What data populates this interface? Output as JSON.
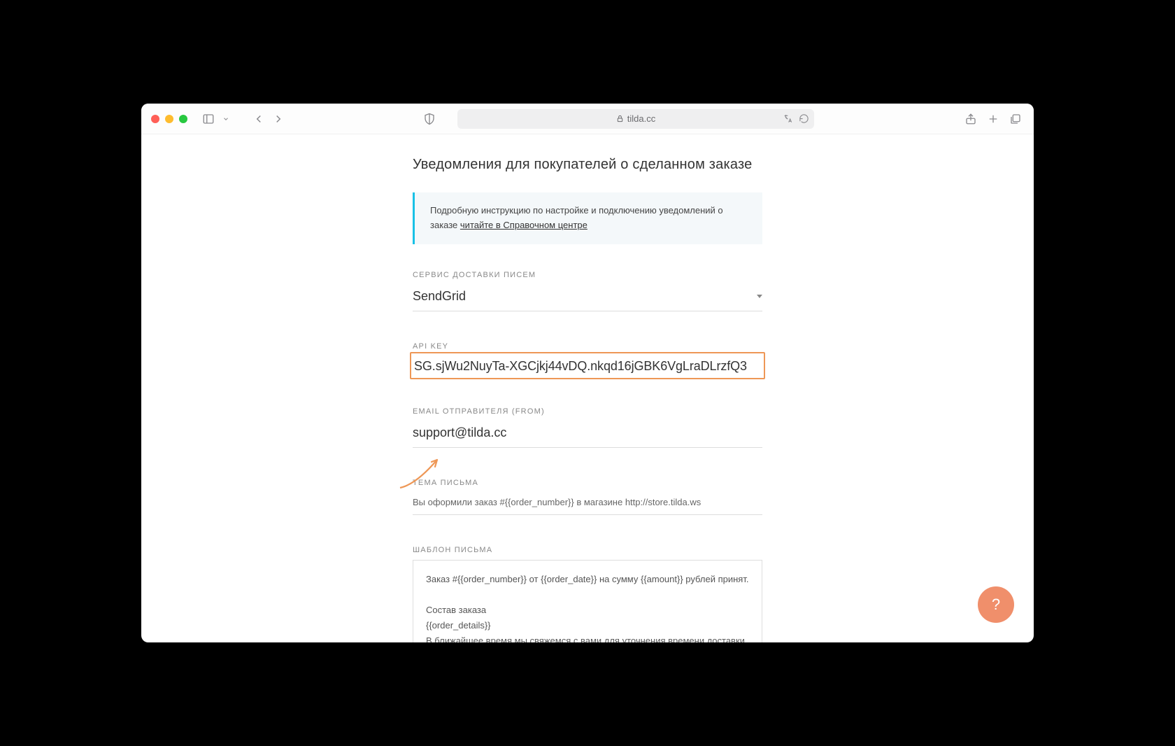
{
  "browser": {
    "url_host": "tilda.cc"
  },
  "page": {
    "title": "Уведомления для покупателей о сделанном заказе",
    "info_text": "Подробную инструкцию по настройке и подключению уведомлений о заказе ",
    "info_link": "читайте в Справочном центре",
    "fields": {
      "service": {
        "label": "СЕРВИС ДОСТАВКИ ПИСЕМ",
        "value": "SendGrid"
      },
      "api_key": {
        "label": "API KEY",
        "value": "SG.sjWu2NuyTa-XGCjkj44vDQ.nkqd16jGBK6VgLraDLrzfQ3"
      },
      "from_email": {
        "label": "EMAIL ОТПРАВИТЕЛЯ (FROM)",
        "value": "support@tilda.cc"
      },
      "subject": {
        "label": "ТЕМА ПИСЬМА",
        "value": "Вы оформили заказ #{{order_number}} в магазине http://store.tilda.ws"
      },
      "template": {
        "label": "ШАБЛОН ПИСЬМА",
        "value": "Заказ #{{order_number}} от {{order_date}} на сумму {{amount}} рублей принят.\n\nСостав заказа\n{{order_details}}\nВ ближайшее время мы свяжемся с вами для уточнения времени доставки."
      }
    },
    "help_label": "?"
  },
  "colors": {
    "highlight": "#ee9756",
    "info_accent": "#19c1e6",
    "fab": "#f08f6b"
  }
}
